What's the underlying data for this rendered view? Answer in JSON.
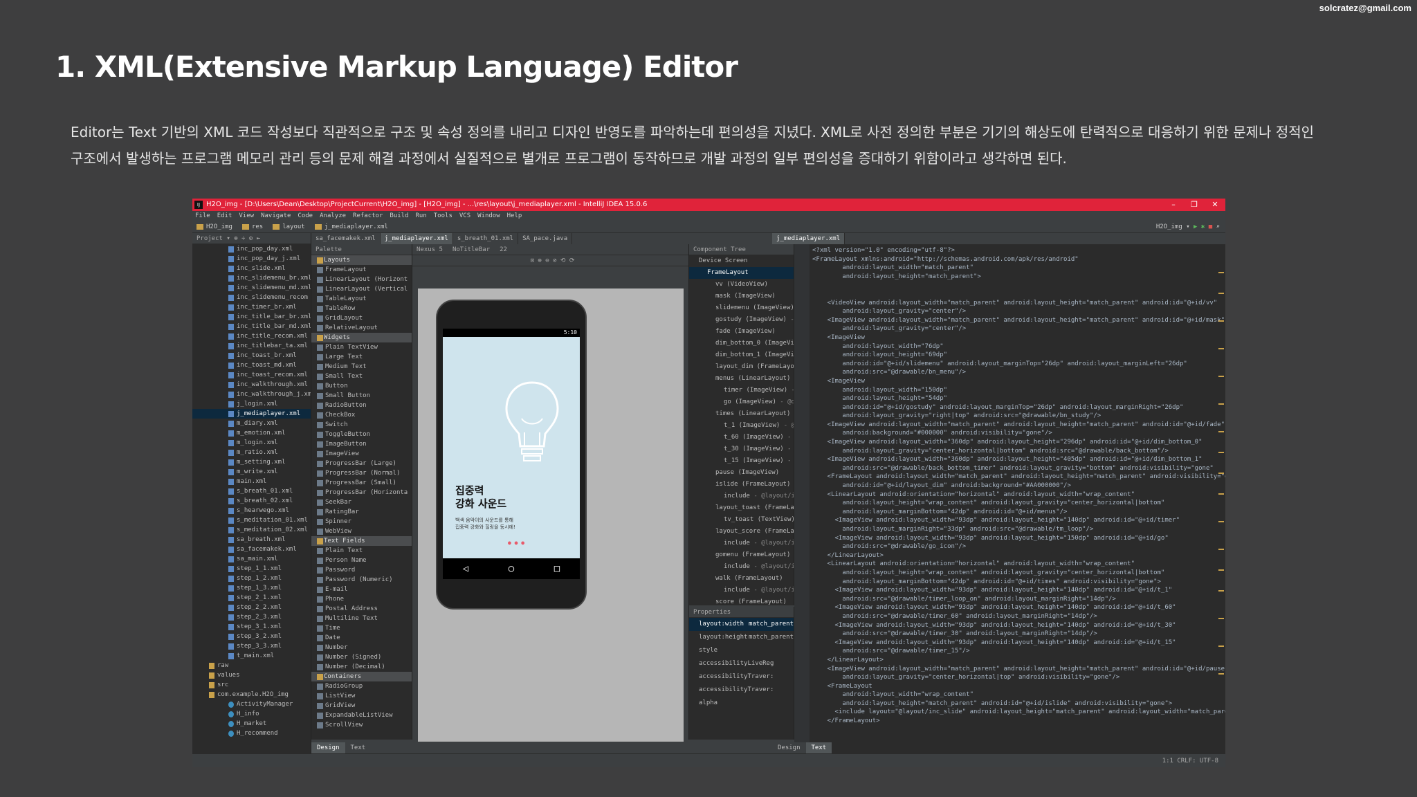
{
  "slide": {
    "email": "solcratez@gmail.com",
    "title": "1. XML(Extensive Markup Language) Editor",
    "desc_line1": "Editor는 Text 기반의 XML 코드 작성보다 직관적으로 구조 및 속성 정의를 내리고 디자인 반영도를 파악하는데 편의성을 지녔다. XML로 사전 정의한 부분은 기기의 해상도에 탄력적으로 대응하기 위한 문제나 정적인",
    "desc_line2": "구조에서 발생하는 프로그램 메모리 관리 등의 문제 해결 과정에서 실질적으로 별개로 프로그램이 동작하므로 개발 과정의 일부 편의성을 증대하기 위함이라고 생각하면 된다."
  },
  "ide": {
    "window_title": "H2O_img - [D:\\Users\\Dean\\Desktop\\ProjectCurrent\\H2O_img] - [H2O_img] - ...\\res\\layout\\j_mediaplayer.xml - IntelliJ IDEA 15.0.6",
    "logo": "IJ",
    "menu": [
      "File",
      "Edit",
      "View",
      "Navigate",
      "Code",
      "Analyze",
      "Refactor",
      "Build",
      "Run",
      "Tools",
      "VCS",
      "Window",
      "Help"
    ],
    "breadcrumbs": [
      "H2O_img",
      "res",
      "layout",
      "j_mediaplayer.xml"
    ],
    "run_config": "H2O_img",
    "project_label": "Project",
    "project_files": [
      "inc_pop_day.xml",
      "inc_pop_day_j.xml",
      "inc_slide.xml",
      "inc_slidemenu_br.xml",
      "inc_slidemenu_md.xml",
      "inc_slidemenu_recom",
      "inc_timer_br.xml",
      "inc_title_bar_br.xml",
      "inc_title_bar_md.xml",
      "inc_title_recom.xml",
      "inc_titlebar_ta.xml",
      "inc_toast_br.xml",
      "inc_toast_md.xml",
      "inc_toast_recom.xml",
      "inc_walkthrough.xml",
      "inc_walkthrough_j.xml",
      "j_login.xml",
      "j_mediaplayer.xml",
      "m_diary.xml",
      "m_emotion.xml",
      "m_login.xml",
      "m_ratio.xml",
      "m_setting.xml",
      "m_write.xml",
      "main.xml",
      "s_breath_01.xml",
      "s_breath_02.xml",
      "s_hearwego.xml",
      "s_meditation_01.xml",
      "s_meditation_02.xml",
      "sa_breath.xml",
      "sa_facemakek.xml",
      "sa_main.xml",
      "step_1_1.xml",
      "step_1_2.xml",
      "step_1_3.xml",
      "step_2_1.xml",
      "step_2_2.xml",
      "step_2_3.xml",
      "step_3_1.xml",
      "step_3_2.xml",
      "step_3_3.xml",
      "t_main.xml"
    ],
    "project_dirs": [
      "raw",
      "values",
      "src",
      "com.example.H2O_img"
    ],
    "project_classes": [
      "ActivityManager",
      "H_info",
      "H_market",
      "H_recommend"
    ],
    "editor_tabs": [
      "sa_facemakek.xml",
      "j_mediaplayer.xml",
      "s_breath_01.xml",
      "SA_pace.java"
    ],
    "right_tab": "j_mediaplayer.xml",
    "palette_label": "Palette",
    "palette": [
      {
        "t": "Layouts",
        "c": true
      },
      {
        "t": "FrameLayout"
      },
      {
        "t": "LinearLayout (Horizont"
      },
      {
        "t": "LinearLayout (Vertical"
      },
      {
        "t": "TableLayout"
      },
      {
        "t": "TableRow"
      },
      {
        "t": "GridLayout"
      },
      {
        "t": "RelativeLayout"
      },
      {
        "t": "Widgets",
        "c": true
      },
      {
        "t": "Plain TextView"
      },
      {
        "t": "Large Text"
      },
      {
        "t": "Medium Text"
      },
      {
        "t": "Small Text"
      },
      {
        "t": "Button"
      },
      {
        "t": "Small Button"
      },
      {
        "t": "RadioButton"
      },
      {
        "t": "CheckBox"
      },
      {
        "t": "Switch"
      },
      {
        "t": "ToggleButton"
      },
      {
        "t": "ImageButton"
      },
      {
        "t": "ImageView"
      },
      {
        "t": "ProgressBar (Large)"
      },
      {
        "t": "ProgressBar (Normal)"
      },
      {
        "t": "ProgressBar (Small)"
      },
      {
        "t": "ProgressBar (Horizonta"
      },
      {
        "t": "SeekBar"
      },
      {
        "t": "RatingBar"
      },
      {
        "t": "Spinner"
      },
      {
        "t": "WebView"
      },
      {
        "t": "Text Fields",
        "c": true
      },
      {
        "t": "Plain Text"
      },
      {
        "t": "Person Name"
      },
      {
        "t": "Password"
      },
      {
        "t": "Password (Numeric)"
      },
      {
        "t": "E-mail"
      },
      {
        "t": "Phone"
      },
      {
        "t": "Postal Address"
      },
      {
        "t": "Multiline Text"
      },
      {
        "t": "Time"
      },
      {
        "t": "Date"
      },
      {
        "t": "Number"
      },
      {
        "t": "Number (Signed)"
      },
      {
        "t": "Number (Decimal)"
      },
      {
        "t": "Containers",
        "c": true
      },
      {
        "t": "RadioGroup"
      },
      {
        "t": "ListView"
      },
      {
        "t": "GridView"
      },
      {
        "t": "ExpandableListView"
      },
      {
        "t": "ScrollView"
      }
    ],
    "design_toolbar": [
      "Nexus 5",
      "NoTitleBar",
      "22"
    ],
    "phone": {
      "status": "5:10",
      "heading1": "집중력",
      "heading2": "강화 사운드",
      "para1": "백색 음악이의 사운드를 통해",
      "para2": "집중력 강화와 힐링을 동시에!",
      "dots": "● ● ●",
      "nav_back": "◁",
      "nav_home": "○",
      "nav_recent": "□"
    },
    "component_tree_label": "Component Tree",
    "component_tree": [
      {
        "n": "Device Screen",
        "d": "",
        "l": 0
      },
      {
        "n": "FrameLayout",
        "d": "",
        "l": 1,
        "sel": true
      },
      {
        "n": "vv (VideoView)",
        "d": "",
        "l": 2
      },
      {
        "n": "mask (ImageView)",
        "d": "",
        "l": 2
      },
      {
        "n": "slidemenu (ImageView)",
        "d": "- @drawable/b",
        "l": 2
      },
      {
        "n": "gostudy (ImageView)",
        "d": "- @drawable/bn_",
        "l": 2
      },
      {
        "n": "fade (ImageView)",
        "d": "",
        "l": 2
      },
      {
        "n": "dim_bottom_0 (ImageView)",
        "d": "- @drawabl",
        "l": 2
      },
      {
        "n": "dim_bottom_1 (ImageView)",
        "d": "- @drawabl",
        "l": 2
      },
      {
        "n": "layout_dim (FrameLayout)",
        "d": "",
        "l": 2
      },
      {
        "n": "menus (LinearLayout)",
        "d": "(horizontal)",
        "l": 2
      },
      {
        "n": "timer (ImageView)",
        "d": "- @drawable/t",
        "l": 3
      },
      {
        "n": "go (ImageView)",
        "d": "- @drawable/go_i",
        "l": 3
      },
      {
        "n": "times (LinearLayout)",
        "d": "(horizontal)",
        "l": 2
      },
      {
        "n": "t_1 (ImageView)",
        "d": "- @drawable/tim",
        "l": 3
      },
      {
        "n": "t_60 (ImageView)",
        "d": "- @drawable/ti",
        "l": 3
      },
      {
        "n": "t_30 (ImageView)",
        "d": "- @drawable/ti",
        "l": 3
      },
      {
        "n": "t_15 (ImageView)",
        "d": "- @drawable/ti",
        "l": 3
      },
      {
        "n": "pause (ImageView)",
        "d": "",
        "l": 2
      },
      {
        "n": "islide (FrameLayout)",
        "d": "",
        "l": 2
      },
      {
        "n": "include",
        "d": "- @layout/inc_slide",
        "l": 3
      },
      {
        "n": "layout_toast (FrameLayout)",
        "d": "",
        "l": 2
      },
      {
        "n": "tv_toast (TextView)",
        "d": "- \"이유 변경",
        "l": 3
      },
      {
        "n": "layout_score (FrameLayout)",
        "d": "",
        "l": 2
      },
      {
        "n": "include",
        "d": "- @layout/inc_pop_day",
        "l": 3
      },
      {
        "n": "gomenu (FrameLayout)",
        "d": "",
        "l": 2
      },
      {
        "n": "include",
        "d": "- @layout/inc_menus",
        "l": 3
      },
      {
        "n": "walk (FrameLayout)",
        "d": "",
        "l": 2
      },
      {
        "n": "include",
        "d": "- @layout/inc_walkthroug",
        "l": 3
      },
      {
        "n": "score (FrameLayout)",
        "d": "",
        "l": 2
      },
      {
        "n": "include",
        "d": "- @layout/inc_pop_day_j",
        "l": 3
      }
    ],
    "properties_label": "Properties",
    "properties": [
      {
        "k": "layout:width",
        "v": "match_parent",
        "sel": true
      },
      {
        "k": "layout:height",
        "v": "match_parent"
      },
      {
        "k": "style",
        "v": ""
      },
      {
        "k": "accessibilityLiveReg",
        "v": ""
      },
      {
        "k": "accessibilityTraver:",
        "v": ""
      },
      {
        "k": "accessibilityTraver:",
        "v": ""
      },
      {
        "k": "alpha",
        "v": ""
      }
    ],
    "xml_code": "<?xml version=\"1.0\" encoding=\"utf-8\"?>\n<FrameLayout xmlns:android=\"http://schemas.android.com/apk/res/android\"\n        android:layout_width=\"match_parent\"\n        android:layout_height=\"match_parent\">\n\n\n    <VideoView android:layout_width=\"match_parent\" android:layout_height=\"match_parent\" android:id=\"@+id/vv\"\n        android:layout_gravity=\"center\"/>\n    <ImageView android:layout_width=\"match_parent\" android:layout_height=\"match_parent\" android:id=\"@+id/mask\"\n        android:layout_gravity=\"center\"/>\n    <ImageView\n        android:layout_width=\"76dp\"\n        android:layout_height=\"69dp\"\n        android:id=\"@+id/slidemenu\" android:layout_marginTop=\"26dp\" android:layout_marginLeft=\"26dp\"\n        android:src=\"@drawable/bn_menu\"/>\n    <ImageView\n        android:layout_width=\"150dp\"\n        android:layout_height=\"54dp\"\n        android:id=\"@+id/gostudy\" android:layout_marginTop=\"26dp\" android:layout_marginRight=\"26dp\"\n        android:layout_gravity=\"right|top\" android:src=\"@drawable/bn_study\"/>\n    <ImageView android:layout_width=\"match_parent\" android:layout_height=\"match_parent\" android:id=\"@+id/fade\"\n        android:background=\"#000000\" android:visibility=\"gone\"/>\n    <ImageView android:layout_width=\"360dp\" android:layout_height=\"296dp\" android:id=\"@+id/dim_bottom_0\"\n        android:layout_gravity=\"center_horizontal|bottom\" android:src=\"@drawable/back_bottom\"/>\n    <ImageView android:layout_width=\"360dp\" android:layout_height=\"405dp\" android:id=\"@+id/dim_bottom_1\"\n        android:src=\"@drawable/back_bottom_timer\" android:layout_gravity=\"bottom\" android:visibility=\"gone\"\n    <FrameLayout android:layout_width=\"match_parent\" android:layout_height=\"match_parent\" android:visibility=\"gone\"\n        android:id=\"@+id/layout_dim\" android:background=\"#AA000000\"/>\n    <LinearLayout android:orientation=\"horizontal\" android:layout_width=\"wrap_content\"\n        android:layout_height=\"wrap_content\" android:layout_gravity=\"center_horizontal|bottom\"\n        android:layout_marginBottom=\"42dp\" android:id=\"@+id/menus\"/>\n      <ImageView android:layout_width=\"93dp\" android:layout_height=\"140dp\" android:id=\"@+id/timer\"\n        android:layout_marginRight=\"33dp\" android:src=\"@drawable/tm_loop\"/>\n      <ImageView android:layout_width=\"93dp\" android:layout_height=\"150dp\" android:id=\"@+id/go\"\n        android:src=\"@drawable/go_icon\"/>\n    </LinearLayout>\n    <LinearLayout android:orientation=\"horizontal\" android:layout_width=\"wrap_content\"\n        android:layout_height=\"wrap_content\" android:layout_gravity=\"center_horizontal|bottom\"\n        android:layout_marginBottom=\"42dp\" android:id=\"@+id/times\" android:visibility=\"gone\">\n      <ImageView android:layout_width=\"93dp\" android:layout_height=\"140dp\" android:id=\"@+id/t_1\"\n        android:src=\"@drawable/timer_loop_on\" android:layout_marginRight=\"14dp\"/>\n      <ImageView android:layout_width=\"93dp\" android:layout_height=\"140dp\" android:id=\"@+id/t_60\"\n        android:src=\"@drawable/timer_60\" android:layout_marginRight=\"14dp\"/>\n      <ImageView android:layout_width=\"93dp\" android:layout_height=\"140dp\" android:id=\"@+id/t_30\"\n        android:src=\"@drawable/timer_30\" android:layout_marginRight=\"14dp\"/>\n      <ImageView android:layout_width=\"93dp\" android:layout_height=\"140dp\" android:id=\"@+id/t_15\"\n        android:src=\"@drawable/timer_15\"/>\n    </LinearLayout>\n    <ImageView android:layout_width=\"match_parent\" android:layout_height=\"match_parent\" android:id=\"@+id/pause\"\n        android:layout_gravity=\"center_horizontal|top\" android:visibility=\"gone\"/>\n    <FrameLayout\n        android:layout_width=\"wrap_content\"\n        android:layout_height=\"match_parent\" android:id=\"@+id/islide\" android:visibility=\"gone\">\n      <include layout=\"@layout/inc_slide\" android:layout_height=\"match_parent\" android:layout_width=\"match_parent\n    </FrameLayout>",
    "design_tab": "Design",
    "text_tab": "Text",
    "status": "1:1  CRLF:  UTF-8"
  }
}
